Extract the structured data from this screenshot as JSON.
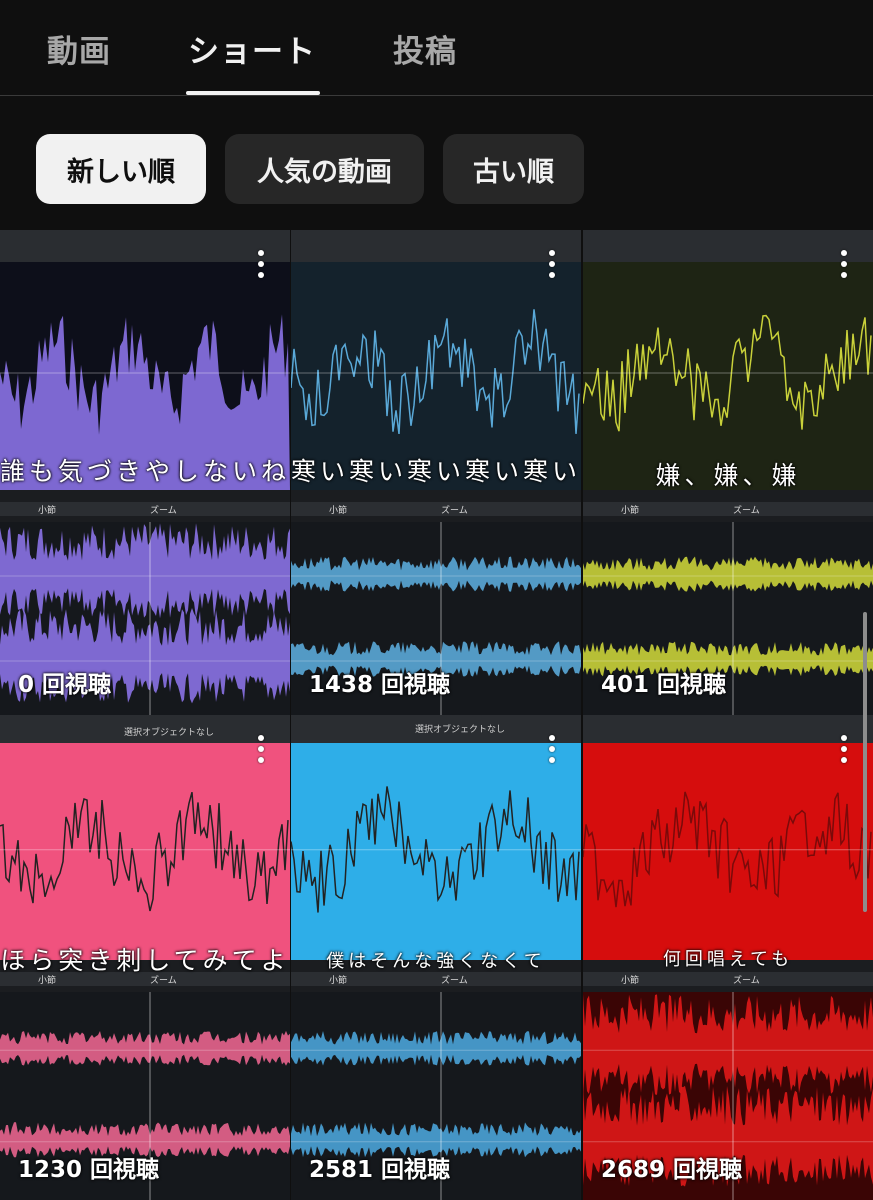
{
  "tabs": [
    {
      "label": "動画",
      "active": false
    },
    {
      "label": "ショート",
      "active": true
    },
    {
      "label": "投稿",
      "active": false
    }
  ],
  "filters": [
    {
      "label": "新しい順",
      "active": true
    },
    {
      "label": "人気の動画",
      "active": false
    },
    {
      "label": "古い順",
      "active": false
    }
  ],
  "shorts": [
    {
      "views": "0 回視聴",
      "caption": "誰も気づきやしないね",
      "wave_color": "#8a72e6",
      "bg_color": "#0d0f1a"
    },
    {
      "views": "1438 回視聴",
      "caption": "寒い寒い寒い寒い寒い",
      "wave_color": "#5aa9d8",
      "bg_color": "#14222c"
    },
    {
      "views": "401 回視聴",
      "caption": "嫌、嫌、嫌",
      "wave_color": "#c9d13a",
      "bg_color": "#1e2414"
    },
    {
      "views": "1230 回視聴",
      "caption": "ほら突き刺してみてよ",
      "wave_color": "#e8648e",
      "bg_color": "#f0527e"
    },
    {
      "views": "2581 回視聴",
      "caption": "僕はそんな強くなくて",
      "wave_color": "#4aa3d8",
      "bg_color": "#2eaee8"
    },
    {
      "views": "2689 回視聴",
      "caption": "何回唱えても",
      "wave_color": "#e01818",
      "bg_color": "#d60d0d"
    }
  ],
  "overlay_text": {
    "no_selection": "選択オブジェクトなし",
    "measure": "小節",
    "zoom": "ズーム"
  },
  "icons": [
    "more-vert-icon"
  ]
}
